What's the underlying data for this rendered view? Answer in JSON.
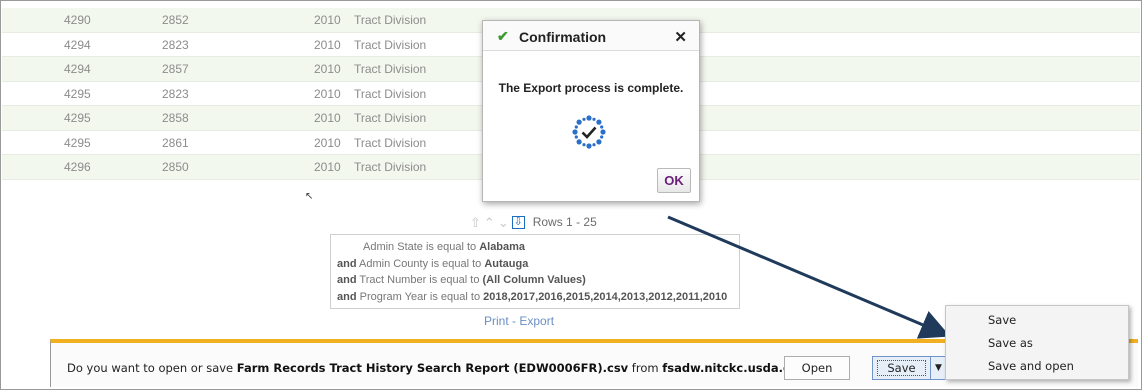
{
  "table": {
    "rows": [
      {
        "c1": "4290",
        "c2": "2852",
        "c3": "2010",
        "c4": "Tract Division",
        "alt": true
      },
      {
        "c1": "4294",
        "c2": "2823",
        "c3": "2010",
        "c4": "Tract Division",
        "alt": false
      },
      {
        "c1": "4294",
        "c2": "2857",
        "c3": "2010",
        "c4": "Tract Division",
        "alt": true
      },
      {
        "c1": "4295",
        "c2": "2823",
        "c3": "2010",
        "c4": "Tract Division",
        "alt": false
      },
      {
        "c1": "4295",
        "c2": "2858",
        "c3": "2010",
        "c4": "Tract Division",
        "alt": true
      },
      {
        "c1": "4295",
        "c2": "2861",
        "c3": "2010",
        "c4": "Tract Division",
        "alt": false
      },
      {
        "c1": "4296",
        "c2": "2850",
        "c3": "2010",
        "c4": "Tract Division",
        "alt": true
      }
    ]
  },
  "pager": {
    "rows_label": "Rows 1 - 25",
    "icons": [
      "first-page-icon",
      "previous-page-icon",
      "next-page-icon",
      "last-page-icon"
    ]
  },
  "filter": {
    "line1": {
      "prefix": "",
      "text": "Admin State is equal to ",
      "value": "Alabama"
    },
    "line2": {
      "prefix": "and",
      "text": " Admin County is equal to ",
      "value": "Autauga"
    },
    "line3": {
      "prefix": "and",
      "text": " Tract Number is equal to ",
      "value": "(All Column Values)"
    },
    "line4": {
      "prefix": "and",
      "text": " Program Year is equal to ",
      "value": "2018,2017,2016,2015,2014,2013,2012,2011,2010"
    }
  },
  "links": {
    "print": "Print",
    "separator": " - ",
    "export": "Export"
  },
  "dialog": {
    "title": "Confirmation",
    "message": "The Export process is complete.",
    "ok": "OK",
    "check_icon": "✔",
    "close_icon": "✕"
  },
  "download_bar": {
    "prefix": "Do you want to open or save ",
    "filename": "Farm Records Tract History Search Report (EDW0006FR).csv",
    "middle": " from ",
    "domain": "fsadw.nitckc.usda.gov",
    "suffix": "?",
    "open": "Open",
    "save": "Save",
    "dropdown": "▼"
  },
  "menu": {
    "items": [
      "Save",
      "Save as",
      "Save and open"
    ]
  },
  "colors": {
    "accent_bar": "#f0b022",
    "arrow": "#1f3a5a",
    "check": "#3c9a2e",
    "ok_text": "#6a1d7a"
  }
}
